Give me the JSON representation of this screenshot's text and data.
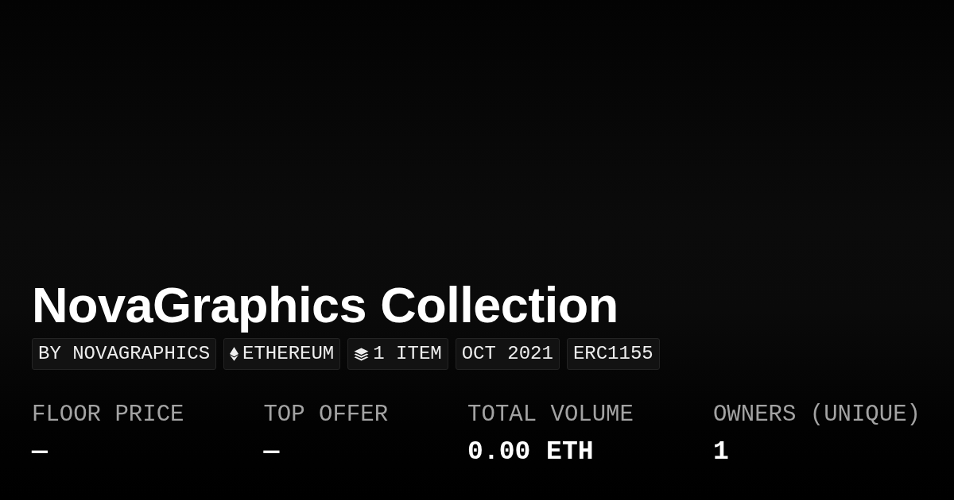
{
  "title": "NovaGraphics Collection",
  "tags": [
    {
      "kind": "text",
      "label": "BY NOVAGRAPHICS"
    },
    {
      "kind": "chain",
      "label": "ETHEREUM"
    },
    {
      "kind": "count",
      "label": "1 ITEM"
    },
    {
      "kind": "text",
      "label": "OCT 2021"
    },
    {
      "kind": "text",
      "label": "ERC1155"
    }
  ],
  "stats": [
    {
      "label": "FLOOR PRICE",
      "value": "—"
    },
    {
      "label": "TOP OFFER",
      "value": "—"
    },
    {
      "label": "TOTAL VOLUME",
      "value": "0.00 ETH"
    },
    {
      "label": "OWNERS (UNIQUE)",
      "value": "1"
    }
  ]
}
